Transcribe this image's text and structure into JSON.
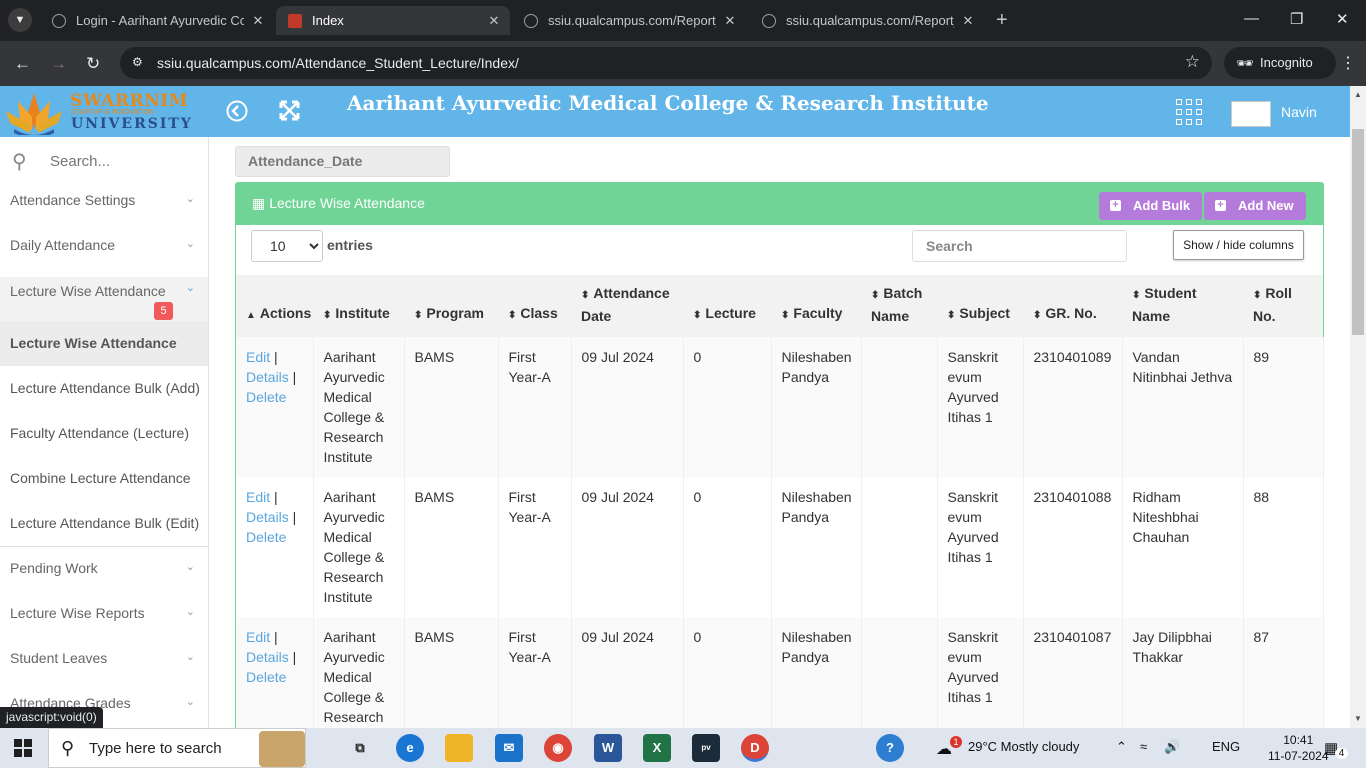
{
  "browser": {
    "tabs": [
      {
        "label": "Login - Aarihant Ayurvedic Colle",
        "active": false
      },
      {
        "label": "Index",
        "active": true
      },
      {
        "label": "ssiu.qualcampus.com/Report_Vi",
        "active": false
      },
      {
        "label": "ssiu.qualcampus.com/Report_Vi",
        "active": false
      }
    ],
    "url": "ssiu.qualcampus.com/Attendance_Student_Lecture/Index/",
    "incognito_label": "Incognito"
  },
  "header": {
    "logo": {
      "line1": "SWARRNIM",
      "line2": "STARTUP & INNOVATION",
      "line3": "UNIVERSITY"
    },
    "title": "Aarihant Ayurvedic Medical College & Research Institute",
    "user": "Navin"
  },
  "sidebar": {
    "search_placeholder": "Search...",
    "items": [
      {
        "label": "Attendance Settings"
      },
      {
        "label": "Daily Attendance"
      },
      {
        "label": "Lecture Wise Attendance",
        "badge": "5"
      }
    ],
    "subitems": [
      {
        "label": "Lecture Wise Attendance"
      },
      {
        "label": "Lecture Attendance Bulk (Add)"
      },
      {
        "label": "Faculty Attendance (Lecture)"
      },
      {
        "label": "Combine Lecture Attendance"
      },
      {
        "label": "Lecture Attendance Bulk (Edit)"
      }
    ],
    "items_after": [
      {
        "label": "Pending Work"
      },
      {
        "label": "Lecture Wise Reports"
      },
      {
        "label": "Student Leaves"
      },
      {
        "label": "Attendance Grades"
      }
    ]
  },
  "status_bar": "javascript:void(0)",
  "main": {
    "date_field": "Attendance_Date",
    "panel_title": "Lecture Wise Attendance",
    "add_bulk": "Add Bulk",
    "add_new": "Add New",
    "entries_value": "10",
    "entries_label": "entries",
    "search_placeholder": "Search",
    "show_hide": "Show / hide columns",
    "columns": [
      "Actions",
      "Institute",
      "Program",
      "Class",
      "Attendance Date",
      "Lecture",
      "Faculty",
      "Batch Name",
      "Subject",
      "GR. No.",
      "Student Name",
      "Roll No."
    ],
    "action_labels": {
      "edit": "Edit",
      "details": "Details",
      "delete": "Delete"
    },
    "rows": [
      {
        "institute": "Aarihant Ayurvedic Medical College & Research Institute",
        "program": "BAMS",
        "class": "First Year-A",
        "date": "09 Jul 2024",
        "lecture": "0",
        "faculty": "Nileshaben Pandya",
        "batch": "",
        "subject": "Sanskrit evum Ayurved Itihas 1",
        "gr": "2310401089",
        "student": "Vandan Nitinbhai Jethva",
        "roll": "89"
      },
      {
        "institute": "Aarihant Ayurvedic Medical College & Research Institute",
        "program": "BAMS",
        "class": "First Year-A",
        "date": "09 Jul 2024",
        "lecture": "0",
        "faculty": "Nileshaben Pandya",
        "batch": "",
        "subject": "Sanskrit evum Ayurved Itihas 1",
        "gr": "2310401088",
        "student": "Ridham Niteshbhai Chauhan",
        "roll": "88"
      },
      {
        "institute": "Aarihant Ayurvedic Medical College & Research",
        "program": "BAMS",
        "class": "First Year-A",
        "date": "09 Jul 2024",
        "lecture": "0",
        "faculty": "Nileshaben Pandya",
        "batch": "",
        "subject": "Sanskrit evum Ayurved Itihas 1",
        "gr": "2310401087",
        "student": "Jay Dilipbhai Thakkar",
        "roll": "87"
      }
    ]
  },
  "taskbar": {
    "search_text": "Type here to search",
    "weather": "29°C  Mostly cloudy",
    "weather_badge": "1",
    "lang": "ENG",
    "time": "10:41",
    "date": "11-07-2024",
    "notif_count": "4"
  },
  "colors": {
    "header": "#62b5e8",
    "panel": "#6fd495",
    "button": "#b57bdb",
    "link": "#5aa6de",
    "badge": "#f15a5a"
  }
}
